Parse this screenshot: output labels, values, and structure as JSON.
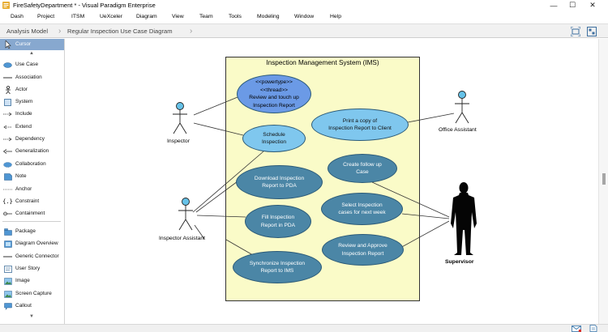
{
  "window": {
    "title": "FireSafetyDepartment * - Visual Paradigm Enterprise",
    "minimize": "—",
    "maximize": "☐",
    "close": "✕"
  },
  "menu": [
    "Dash",
    "Project",
    "ITSM",
    "UeXceler",
    "Diagram",
    "View",
    "Team",
    "Tools",
    "Modeling",
    "Window",
    "Help"
  ],
  "breadcrumbs": [
    "Analysis Model",
    "Regular Inspection Use Case Diagram"
  ],
  "palette": {
    "items": [
      {
        "label": "Cursor",
        "icon": "cursor-icon",
        "selected": true
      },
      {
        "label": "Use Case",
        "icon": "use-case-icon"
      },
      {
        "label": "Association",
        "icon": "association-icon"
      },
      {
        "label": "Actor",
        "icon": "actor-icon"
      },
      {
        "label": "System",
        "icon": "system-icon"
      },
      {
        "label": "Include",
        "icon": "include-icon"
      },
      {
        "label": "Extend",
        "icon": "extend-icon"
      },
      {
        "label": "Dependency",
        "icon": "dependency-icon"
      },
      {
        "label": "Generalization",
        "icon": "generalization-icon"
      },
      {
        "label": "Collaboration",
        "icon": "collaboration-icon"
      },
      {
        "label": "Note",
        "icon": "note-icon"
      },
      {
        "label": "Anchor",
        "icon": "anchor-icon"
      },
      {
        "label": "Constraint",
        "icon": "constraint-icon"
      },
      {
        "label": "Containment",
        "icon": "containment-icon"
      },
      {
        "label": "Package",
        "icon": "package-icon"
      },
      {
        "label": "Diagram Overview",
        "icon": "diagram-overview-icon"
      },
      {
        "label": "Generic Connector",
        "icon": "generic-connector-icon"
      },
      {
        "label": "User Story",
        "icon": "user-story-icon"
      },
      {
        "label": "Image",
        "icon": "image-icon"
      },
      {
        "label": "Screen Capture",
        "icon": "screen-capture-icon"
      },
      {
        "label": "Callout",
        "icon": "callout-icon"
      }
    ]
  },
  "diagram": {
    "system_name": "Inspection Management System (IMS)",
    "actors": {
      "inspector": "Inspector",
      "inspector_assistant": "Inspector Assistant",
      "office_assistant": "Office Assistant",
      "supervisor": "Supervisor"
    },
    "use_cases": {
      "review_touch_up": [
        "<<powertype>>",
        "<<thread>>",
        "Review and touch up",
        "Inspection Report"
      ],
      "schedule_inspection": [
        "Schedule",
        "Inspection"
      ],
      "print_copy": [
        "Print a copy of",
        "Inspection Report to Client"
      ],
      "create_follow_up": [
        "Create follow up",
        "Case"
      ],
      "download_report": [
        "Download Inspection",
        "Report to PDA"
      ],
      "select_cases": [
        "Select Inspection",
        "cases for next week"
      ],
      "fill_report": [
        "Fill Inspection",
        "Report in PDA"
      ],
      "review_approve": [
        "Review and Approve",
        "Inspection Report"
      ],
      "synchronize_report": [
        "Synchronize Inspection",
        "Report to IMS"
      ]
    }
  },
  "colors": {
    "system_fill": "#fafbc8",
    "use_case_light": "#7fc7ee",
    "use_case_dark": "#4b86a6",
    "use_case_stereotyped": "#6b9ae6",
    "actor_fill": "#66c2e8",
    "palette_selected": "#87a8cf"
  }
}
